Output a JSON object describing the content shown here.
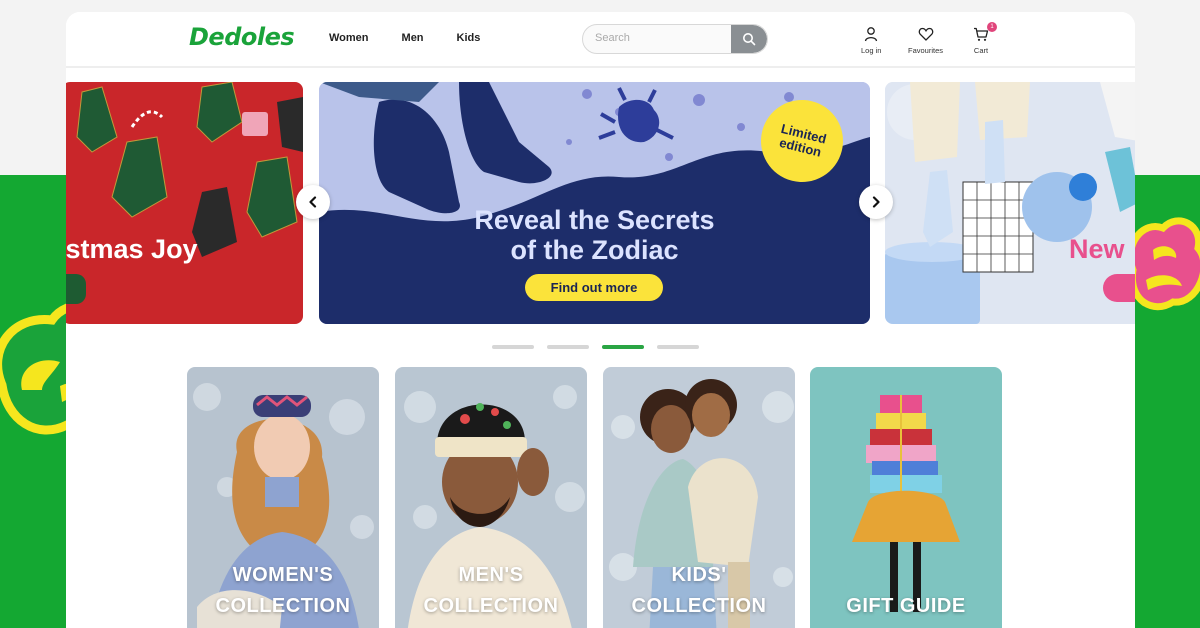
{
  "brand": {
    "logo_text": "Dedoles",
    "primary_color": "#14a832",
    "accent_yellow": "#fbe33a",
    "accent_pink": "#e8508d"
  },
  "nav": {
    "items": [
      {
        "label": "Women"
      },
      {
        "label": "Men"
      },
      {
        "label": "Kids"
      }
    ]
  },
  "search": {
    "placeholder": "Search",
    "value": "",
    "button_icon": "search-icon"
  },
  "header_actions": {
    "login": {
      "label": "Log in",
      "icon": "user-icon"
    },
    "favourites": {
      "label": "Favourites",
      "icon": "heart-icon"
    },
    "cart": {
      "label": "Cart",
      "icon": "cart-icon",
      "count": "1"
    }
  },
  "carousel": {
    "slides": [
      {
        "title": "istmas Joy"
      },
      {
        "headline_line1": "Reveal the Secrets",
        "headline_line2": "of the Zodiac",
        "cta": "Find out more",
        "badge_line1": "Limited",
        "badge_line2": "edition"
      },
      {
        "title": "New"
      }
    ],
    "prev_icon": "chevron-left-icon",
    "next_icon": "chevron-right-icon",
    "indicator_count": 4,
    "active_index": 2
  },
  "collections": [
    {
      "line1": "WOMEN'S",
      "line2": "COLLECTION"
    },
    {
      "line1": "MEN'S",
      "line2": "COLLECTION"
    },
    {
      "line1": "KIDS'",
      "line2": "COLLECTION"
    },
    {
      "line1": "GIFT GUIDE",
      "line2": ""
    }
  ]
}
